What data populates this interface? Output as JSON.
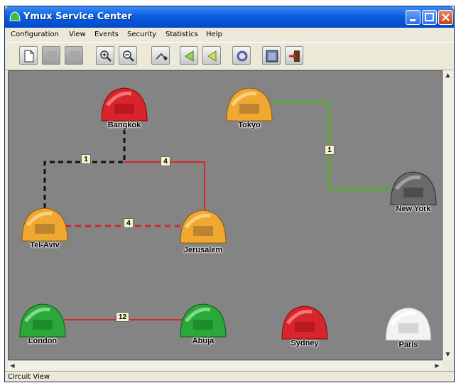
{
  "window": {
    "title": "Ymux Service Center"
  },
  "menu": [
    "Configuration",
    "View",
    "Events",
    "Security",
    "Statistics",
    "Help"
  ],
  "toolbar": [
    {
      "name": "new-icon"
    },
    {
      "name": "disabled-icon-1"
    },
    {
      "name": "disabled-icon-2"
    },
    {
      "name": "zoom-in-icon"
    },
    {
      "name": "zoom-out-icon"
    },
    {
      "name": "route-icon"
    },
    {
      "name": "back-icon"
    },
    {
      "name": "forward-icon"
    },
    {
      "name": "refresh-icon"
    },
    {
      "name": "view-icon"
    },
    {
      "name": "exit-icon"
    }
  ],
  "nodes": [
    {
      "id": "bangkok",
      "label": "Bangkok",
      "color": "#d8242a"
    },
    {
      "id": "tokyo",
      "label": "Tokyo",
      "color": "#f0a830"
    },
    {
      "id": "tel-aviv",
      "label": "Tel-Aviv",
      "color": "#f0a830"
    },
    {
      "id": "jerusalem",
      "label": "Jerusalem",
      "color": "#f0a830"
    },
    {
      "id": "new-york",
      "label": "New York",
      "color": "#6a6a6a"
    },
    {
      "id": "london",
      "label": "London",
      "color": "#2aa83a"
    },
    {
      "id": "abuja",
      "label": "Abuja",
      "color": "#2aa83a"
    },
    {
      "id": "sydney",
      "label": "Sydney",
      "color": "#d8242a"
    },
    {
      "id": "paris",
      "label": "Paris",
      "color": "#f2f2f2"
    }
  ],
  "links": [
    {
      "label": "1",
      "color": "#111111",
      "style": "dashed"
    },
    {
      "label": "4",
      "color": "#d8242a",
      "style": "solid"
    },
    {
      "label": "4",
      "color": "#d8242a",
      "style": "dashed"
    },
    {
      "label": "1",
      "color": "#5aa832",
      "style": "solid"
    },
    {
      "label": "12",
      "color": "#d8242a",
      "style": "solid"
    }
  ],
  "status": "Circuit View"
}
